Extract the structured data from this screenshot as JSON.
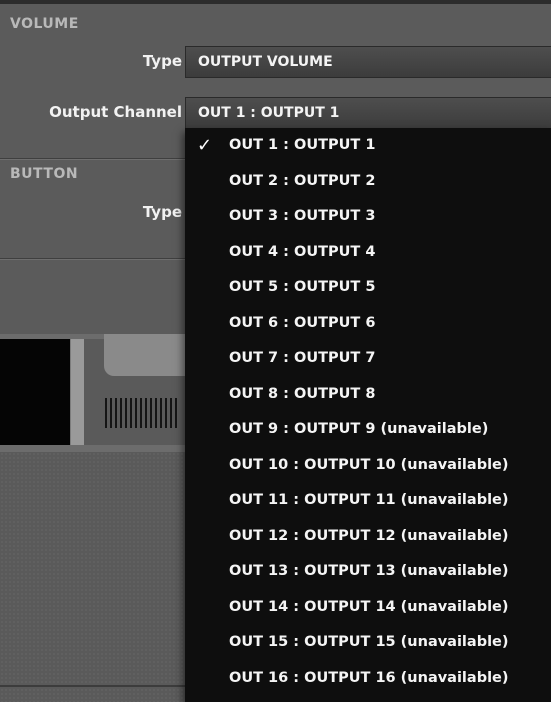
{
  "volume_section": {
    "title": "VOLUME",
    "type_label": "Type",
    "type_value": "OUTPUT VOLUME",
    "channel_label": "Output Channel",
    "channel_value": "OUT 1 : OUTPUT 1"
  },
  "button_section": {
    "title": "BUTTON",
    "type_label": "Type"
  },
  "dropdown": {
    "check_glyph": "✓",
    "selected_index": 0,
    "items": [
      "OUT 1 : OUTPUT 1",
      "OUT 2 : OUTPUT 2",
      "OUT 3 : OUTPUT 3",
      "OUT 4 : OUTPUT 4",
      "OUT 5 : OUTPUT 5",
      "OUT 6 : OUTPUT 6",
      "OUT 7 : OUTPUT 7",
      "OUT 8 : OUTPUT 8",
      "OUT 9 : OUTPUT 9 (unavailable)",
      "OUT 10 : OUTPUT 10 (unavailable)",
      "OUT 11 : OUTPUT 11 (unavailable)",
      "OUT 12 : OUTPUT 12 (unavailable)",
      "OUT 13 : OUTPUT 13 (unavailable)",
      "OUT 14 : OUTPUT 14 (unavailable)",
      "OUT 15 : OUTPUT 15 (unavailable)",
      "OUT 16 : OUTPUT 16 (unavailable)"
    ]
  },
  "colors": {
    "menu_background": "#0e0e0e",
    "panel_background": "#5b5b5b",
    "field_background": "#444444",
    "text": "#f2f2f2",
    "section_label": "#b9b9b9"
  }
}
